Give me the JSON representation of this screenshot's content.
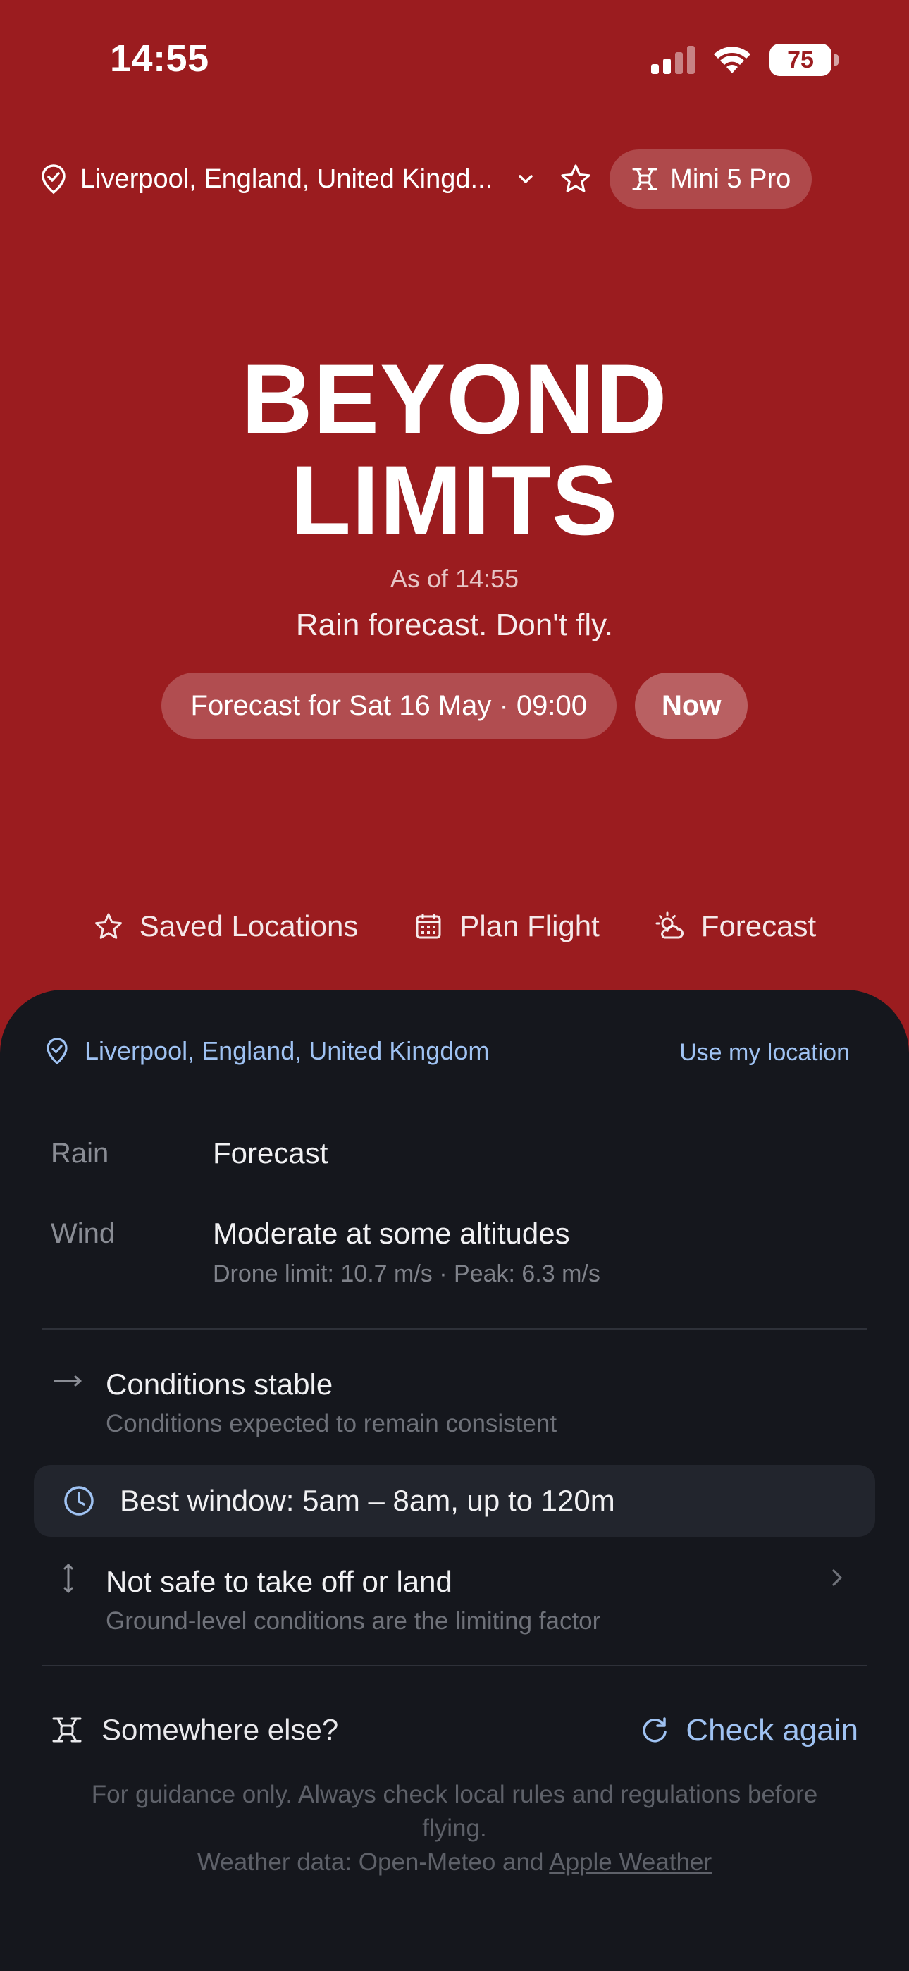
{
  "status_bar": {
    "time": "14:55",
    "battery": "75"
  },
  "top_bar": {
    "location": "Liverpool, England, United Kingd...",
    "drone": "Mini 5 Pro"
  },
  "hero": {
    "title_line1": "BEYOND",
    "title_line2": "LIMITS",
    "as_of": "As of 14:55",
    "verdict": "Rain forecast. Don't fly.",
    "forecast_button": "Forecast for Sat 16 May · 09:00",
    "now_button": "Now"
  },
  "quick_actions": [
    {
      "label": "Saved Locations",
      "icon": "star-icon"
    },
    {
      "label": "Plan Flight",
      "icon": "calendar-icon"
    },
    {
      "label": "Forecast",
      "icon": "sun-cloud-icon"
    }
  ],
  "sheet": {
    "location": "Liverpool, England, United Kingdom",
    "use_location": "Use my location",
    "rain": {
      "label": "Rain",
      "value": "Forecast"
    },
    "wind": {
      "label": "Wind",
      "value": "Moderate at some altitudes",
      "detail": "Drone limit: 10.7 m/s · Peak: 6.3 m/s"
    },
    "trend": {
      "title": "Conditions stable",
      "subtitle": "Conditions expected to remain consistent"
    },
    "best_window": "Best window: 5am – 8am, up to 120m",
    "takeoff": {
      "title": "Not safe to take off or land",
      "subtitle": "Ground-level conditions are the limiting factor"
    },
    "somewhere_else": "Somewhere else?",
    "check_again": "Check again",
    "disclaimer_line1": "For guidance only. Always check local rules and regulations before flying.",
    "disclaimer_line2_prefix": "Weather data: Open-Meteo and ",
    "disclaimer_link": "Apple Weather"
  },
  "colors": {
    "background": "#9b1c1f",
    "sheet": "#15171d",
    "accent": "#9fc2f2"
  }
}
